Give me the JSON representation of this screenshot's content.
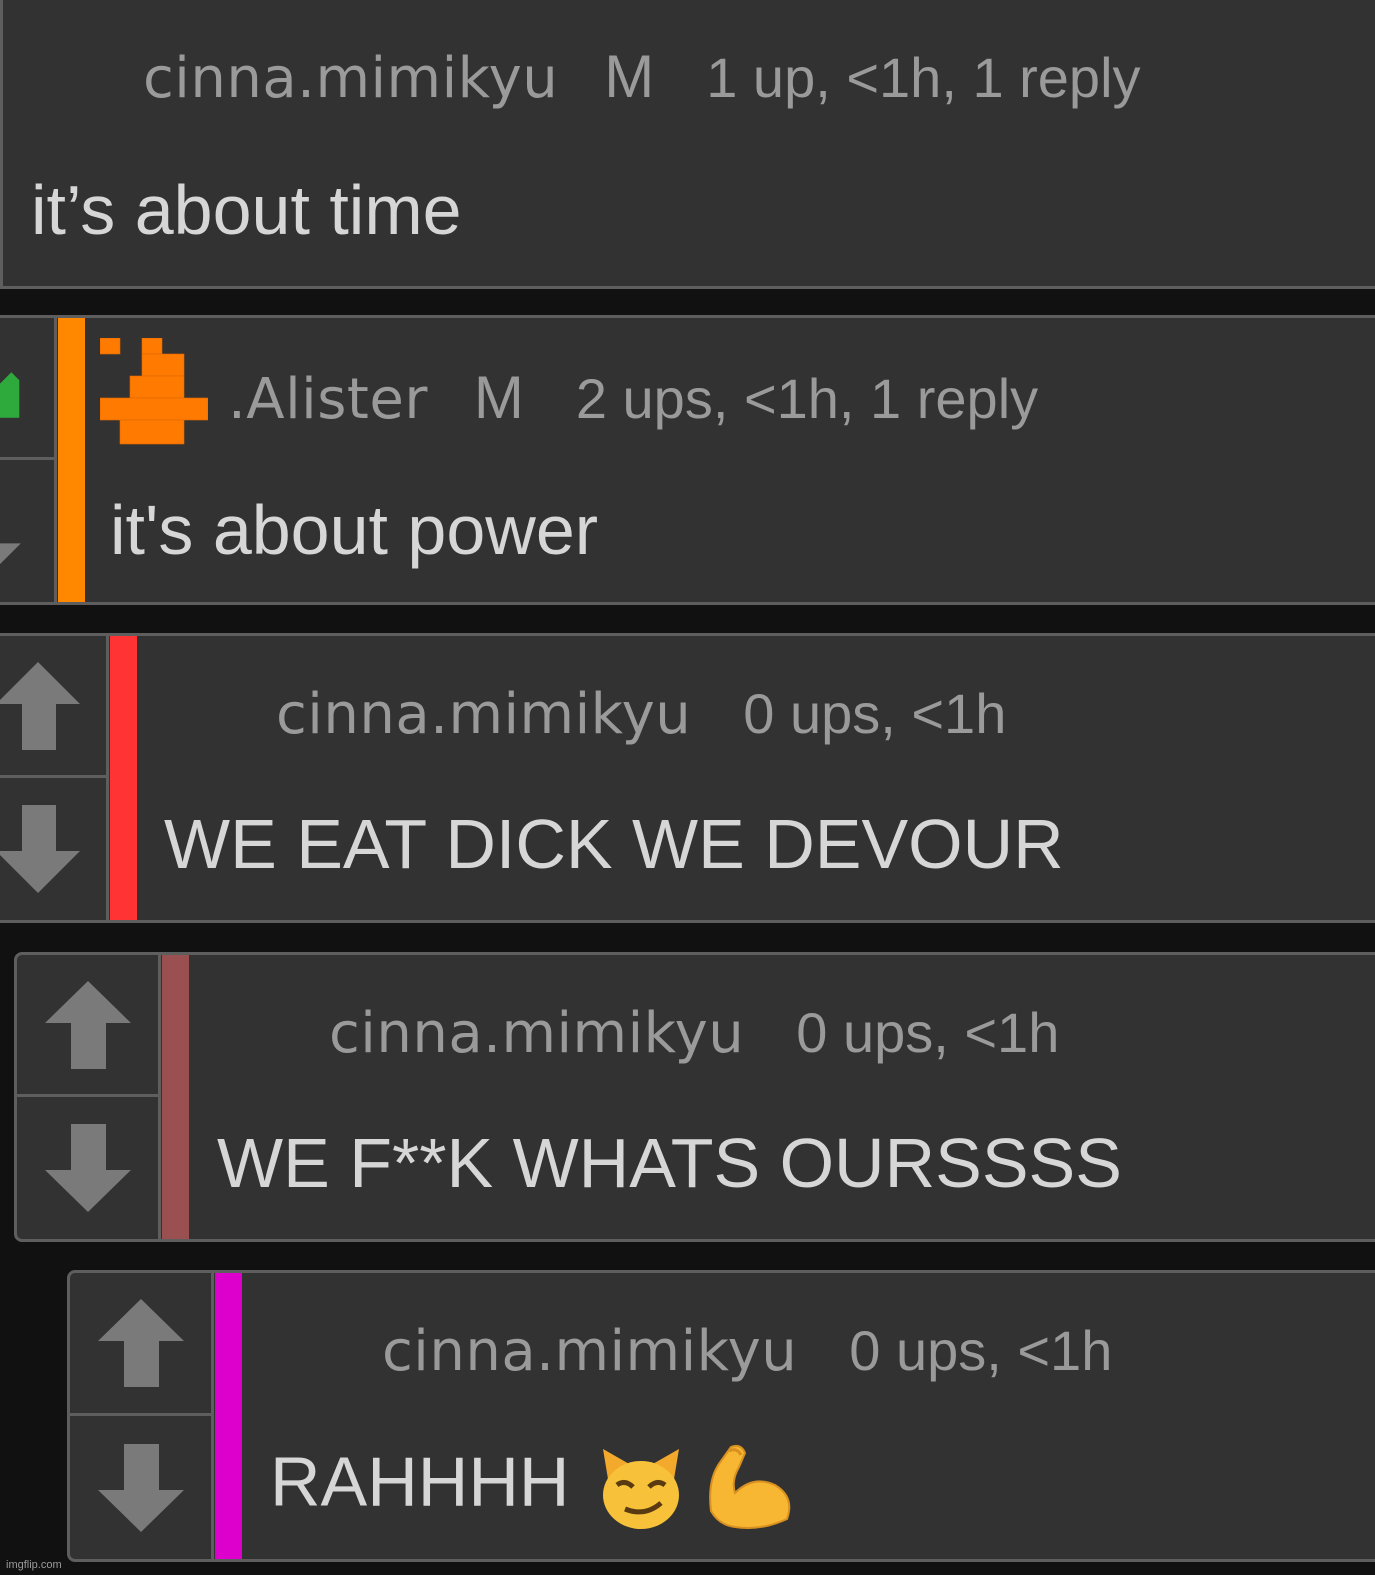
{
  "comments": [
    {
      "username": "cinna.mimikyu",
      "mod_badge": "M",
      "stats": "1 up, <1h, 1 reply",
      "text": "it’s about time"
    },
    {
      "username": ".Alister",
      "mod_badge": "M",
      "stats": "2 ups, <1h, 1 reply",
      "text": "it's about power",
      "thread_color": "#ff8800",
      "upvoted": true
    },
    {
      "username": "cinna.mimikyu",
      "stats": "0 ups, <1h",
      "text": "WE EAT DICK WE DEVOUR",
      "thread_color": "#ff3333"
    },
    {
      "username": "cinna.mimikyu",
      "stats": "0 ups, <1h",
      "text": "WE F**K WHATS OURSSSS",
      "thread_color": "#9a5050"
    },
    {
      "username": "cinna.mimikyu",
      "stats": "0 ups, <1h",
      "text": "RAHHHH",
      "thread_color": "#dd00cc",
      "emojis": [
        "smirking-cat-emoji",
        "flexed-biceps-emoji"
      ]
    }
  ],
  "icons": {
    "upvote": "up-arrow-icon",
    "downvote": "down-arrow-icon",
    "avatar": "pixel-avatar-icon"
  },
  "colors": {
    "arrow": "#7a7a7a",
    "upvoted_arrow": "#2eaa3c",
    "avatar": "#ff7a00"
  },
  "watermark": "imgflip.com"
}
